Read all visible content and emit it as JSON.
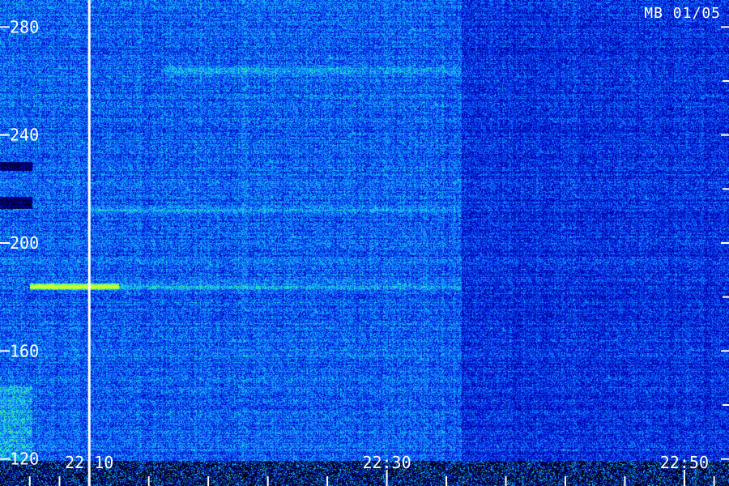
{
  "chart_data": {
    "type": "heatmap",
    "title": "",
    "corner_label": "MB 01/05",
    "xlabel": "",
    "ylabel": "",
    "x_range": [
      "22:04",
      "22:53"
    ],
    "x_ticks": [
      "22:10",
      "22:30",
      "22:50"
    ],
    "x_minor_ticks": [
      "22:06",
      "22:08",
      "22:10",
      "22:14",
      "22:18",
      "22:22",
      "22:26",
      "22:30",
      "22:34",
      "22:38",
      "22:42",
      "22:46",
      "22:50",
      "22:52"
    ],
    "ylim": [
      110,
      290
    ],
    "y_ticks": [
      120,
      160,
      200,
      240,
      280
    ],
    "y_minor_ticks": [
      140,
      180,
      220,
      260
    ],
    "marker_time": "22:10",
    "colormap": [
      "#000000",
      "#00007a",
      "#0000c8",
      "#0a5cff",
      "#18c8ff",
      "#30ff8a",
      "#c8ff30"
    ],
    "features": [
      {
        "kind": "bright_band",
        "y": 184,
        "x_start": "22:06",
        "x_end": "22:12",
        "intensity": 1.0
      },
      {
        "kind": "faint_band",
        "y": 184,
        "x_start": "22:12",
        "x_end": "22:35",
        "intensity": 0.45
      },
      {
        "kind": "faint_band",
        "y": 212,
        "x_start": "22:10",
        "x_end": "22:35",
        "intensity": 0.35
      },
      {
        "kind": "faint_band",
        "y": 264,
        "x_start": "22:15",
        "x_end": "22:35",
        "intensity": 0.4
      },
      {
        "kind": "enhanced_region",
        "y_from": 110,
        "y_to": 290,
        "x_start": "22:04",
        "x_end": "22:35",
        "intensity": 0.25
      }
    ]
  }
}
